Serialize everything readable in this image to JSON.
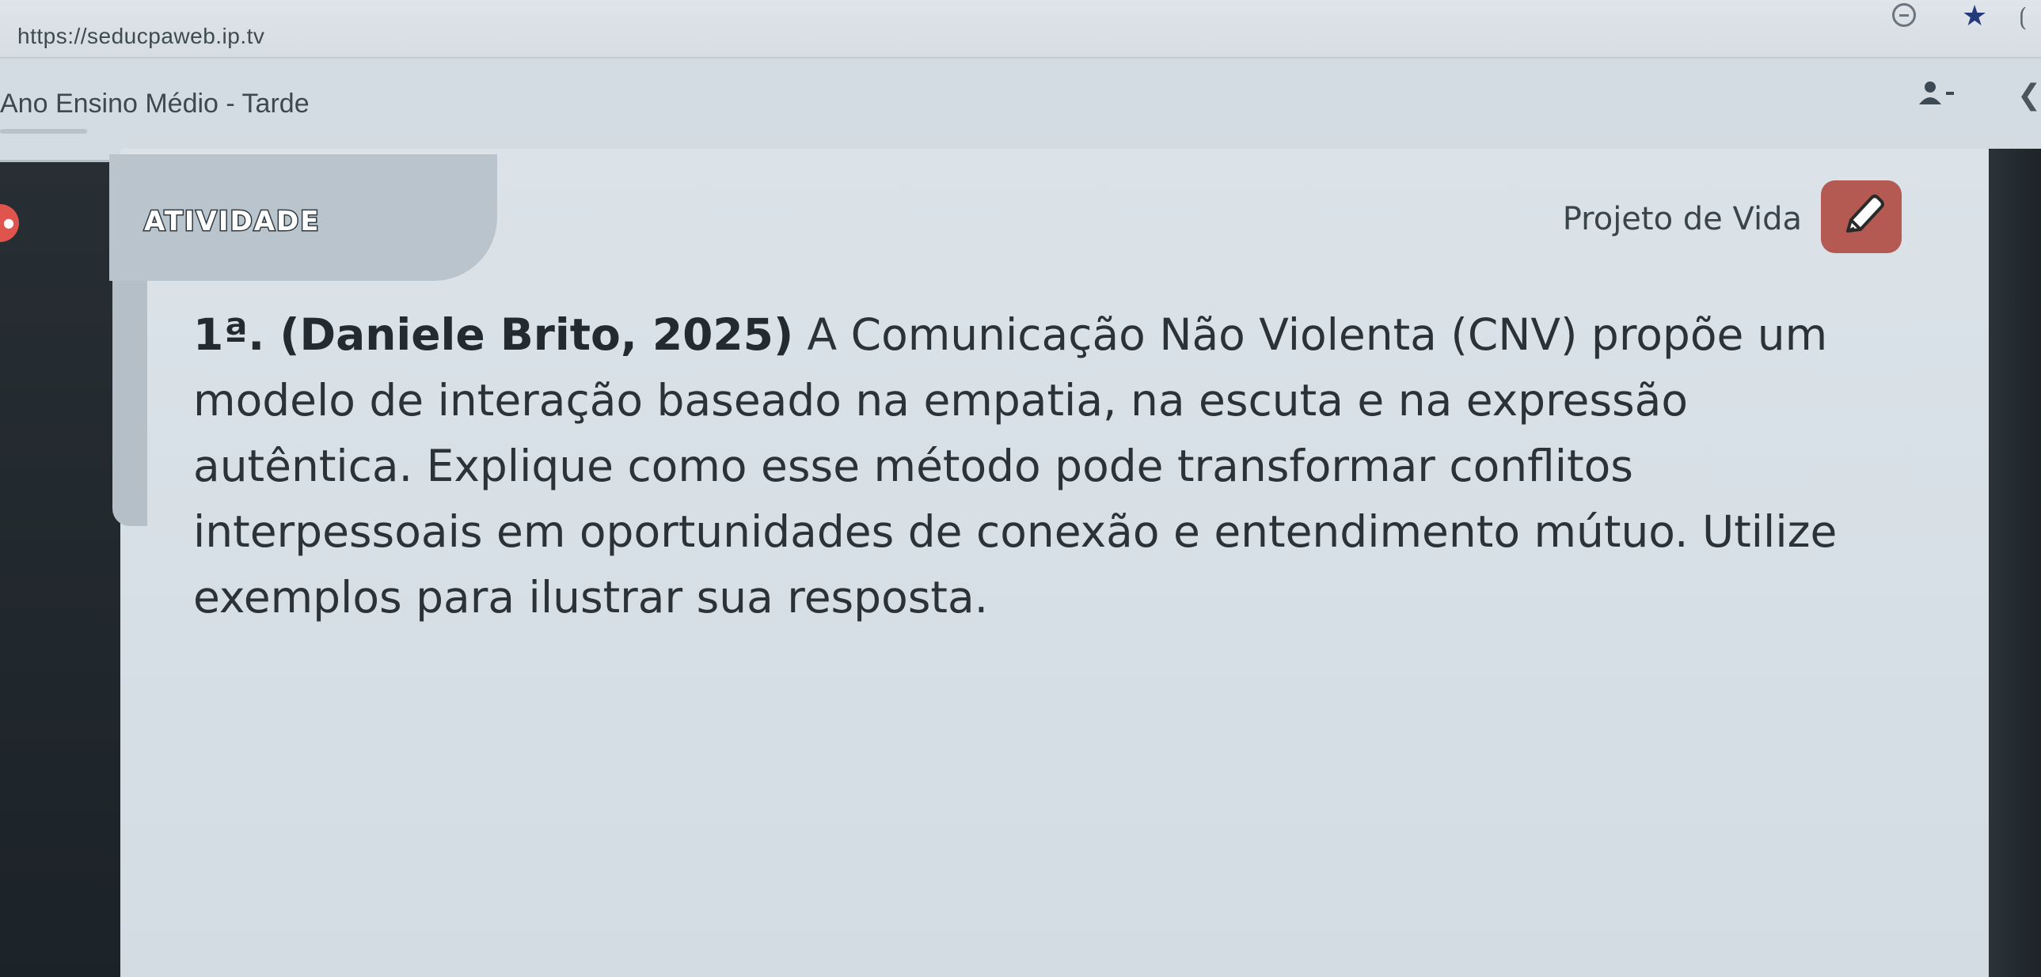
{
  "browser": {
    "url": "https://seducpaweb.ip.tv"
  },
  "header": {
    "class_title": "Ano Ensino Médio - Tarde"
  },
  "slide": {
    "tag": "ATIVIDADE",
    "subject": "Projeto de Vida",
    "question_head": "1ª. (Daniele Brito, 2025)",
    "question_body": " A Comunicação Não Violenta (CNV) propõe um modelo de interação baseado na empatia, na escuta e na expressão autêntica. Explique como esse método pode transformar conflitos interpessoais em oportunidades de conexão e entendimento mútuo. Utilize exemplos para ilustrar sua resposta."
  },
  "icons": {
    "bookmark": "star-icon",
    "edit": "pencil-icon",
    "profile": "person-icon"
  },
  "colors": {
    "pencil_button": "#b45a52",
    "badge": "#e0544e",
    "bookmark_star": "#243a7a"
  }
}
